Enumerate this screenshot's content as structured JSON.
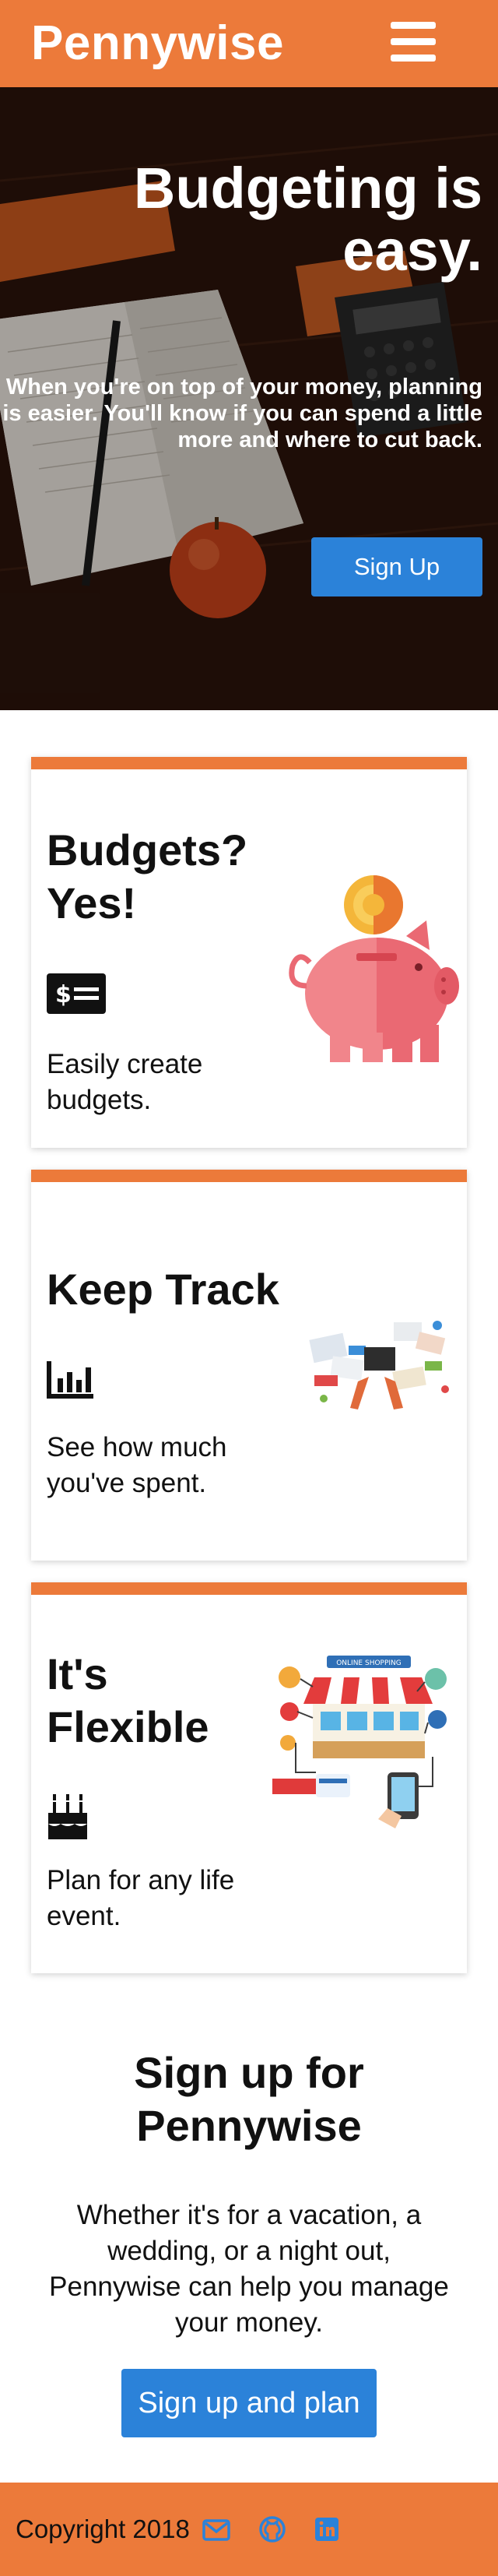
{
  "navbar": {
    "brand": "Pennywise",
    "menu_icon": "hamburger-menu-icon"
  },
  "hero": {
    "title": "Budgeting is easy.",
    "text": "When you're on top of your money, planning is easier. You'll know if you can spend a little more and where to cut back.",
    "button_label": "Sign Up"
  },
  "features": [
    {
      "title": "Budgets? Yes!",
      "icon": "money-bill-icon",
      "text": "Easily create budgets.",
      "image": "piggy-bank-illustration"
    },
    {
      "title": "Keep Track",
      "icon": "bar-chart-icon",
      "text": "See how much you've spent.",
      "image": "desk-tracking-illustration"
    },
    {
      "title": "It's Flexible",
      "icon": "birthday-cake-icon",
      "text": "Plan for any life event.",
      "image": "online-shopping-illustration",
      "image_banner": "ONLINE SHOPPING"
    }
  ],
  "signup": {
    "title": "Sign up for Pennywise",
    "text": "Whether it's for a vacation, a wedding, or a night out, Pennywise can help you manage your money.",
    "button_label": "Sign up and plan"
  },
  "footer": {
    "copyright": "Copyright 2018",
    "icons": [
      "envelope-icon",
      "github-icon",
      "linkedin-icon"
    ]
  },
  "colors": {
    "accent": "#ec7a3a",
    "button": "#2b82d9",
    "icon_blue": "#2b82d9"
  }
}
